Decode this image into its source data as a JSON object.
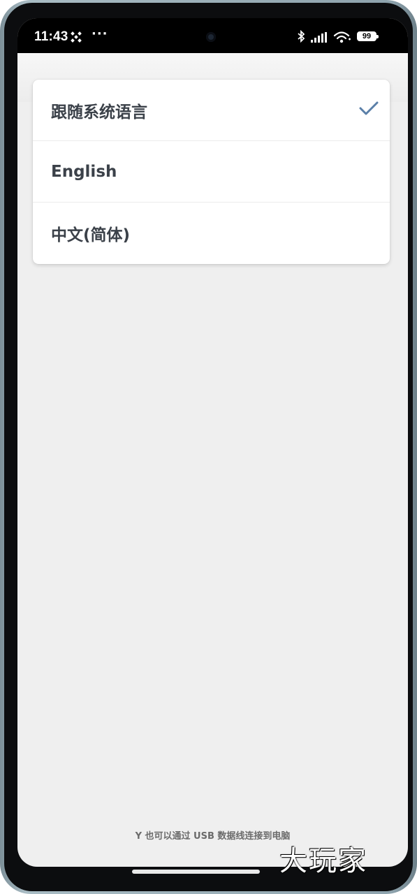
{
  "status_bar": {
    "time": "11:43",
    "overflow_indicator": "···",
    "battery": "99",
    "icons": [
      "satellite-icon",
      "bluetooth-icon",
      "signal-icon",
      "wifi-icon",
      "battery-icon"
    ]
  },
  "language_menu": {
    "items": [
      {
        "label": "跟随系统语言",
        "selected": true
      },
      {
        "label": "English",
        "selected": false
      },
      {
        "label": "中文(简体)",
        "selected": false
      }
    ],
    "check_color": "#5a7fa8"
  },
  "footer": {
    "hint_text": "Y 也可以通过 USB 数据线连接到电脑"
  },
  "watermark": {
    "text": "大玩家"
  }
}
